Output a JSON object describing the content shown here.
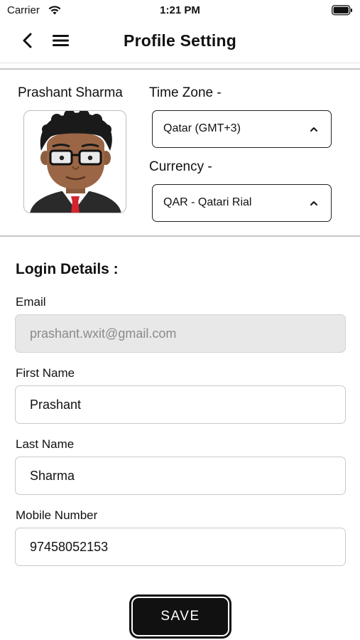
{
  "status_bar": {
    "carrier": "Carrier",
    "time": "1:21 PM",
    "icons": [
      "wifi-icon",
      "battery-icon"
    ]
  },
  "nav": {
    "title": "Profile Setting",
    "icons": [
      "back-icon",
      "menu-icon"
    ]
  },
  "profile": {
    "name": "Prashant Sharma",
    "avatar_icon": "avatar-cartoon",
    "time_zone": {
      "label": "Time Zone -",
      "value": "Qatar (GMT+3)"
    },
    "currency": {
      "label": "Currency -",
      "value": "QAR - Qatari Rial"
    }
  },
  "login": {
    "title": "Login Details :",
    "email": {
      "label": "Email",
      "value": "prashant.wxit@gmail.com"
    },
    "first_name": {
      "label": "First Name",
      "value": "Prashant"
    },
    "last_name": {
      "label": "Last Name",
      "value": "Sharma"
    },
    "mobile": {
      "label": "Mobile Number",
      "value": "97458052153"
    }
  },
  "actions": {
    "save_label": "SAVE"
  },
  "colors": {
    "primary_button": "#111111",
    "disabled_field": "#e8e8e8",
    "divider": "#c7c7c7"
  }
}
